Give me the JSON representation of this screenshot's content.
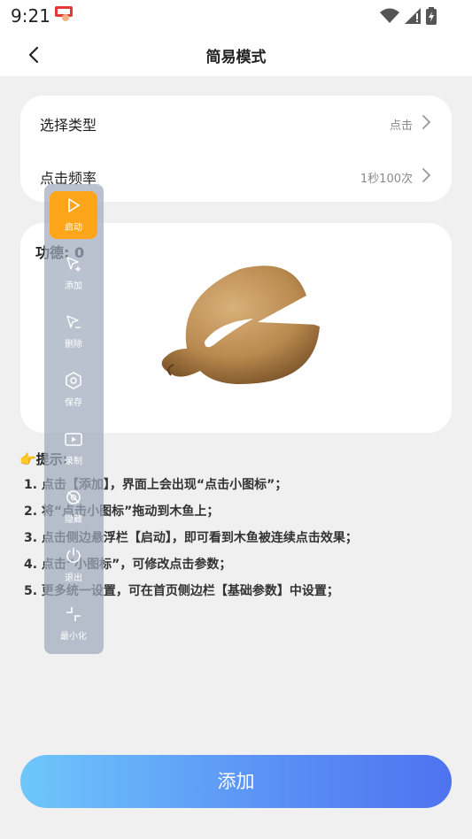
{
  "status": {
    "time": "9:21"
  },
  "header": {
    "title": "简易模式"
  },
  "settings": {
    "type_label": "选择类型",
    "type_value": "点击",
    "freq_label": "点击频率",
    "freq_value": "1秒100次"
  },
  "fish_card": {
    "merit": "功德: 0"
  },
  "tips": {
    "title": "提示:",
    "items": [
      "1. 点击【添加】，界面上会出现“点击小图标”；",
      "2. 将“点击小图标”拖动到木鱼上；",
      "3. 点击侧边悬浮栏【启动】，即可看到木鱼被连续点击效果；",
      "4. 点击“小图标”，可修改点击参数；",
      "5. 更多统一设置，可在首页侧边栏【基础参数】中设置；"
    ]
  },
  "toolbar": {
    "items": [
      {
        "label": "启动",
        "icon": "play-icon"
      },
      {
        "label": "添加",
        "icon": "cursor-plus-icon"
      },
      {
        "label": "删除",
        "icon": "cursor-minus-icon"
      },
      {
        "label": "保存",
        "icon": "hexagon-icon"
      },
      {
        "label": "录制",
        "icon": "record-icon"
      },
      {
        "label": "隐藏",
        "icon": "eye-off-icon"
      },
      {
        "label": "退出",
        "icon": "power-icon"
      },
      {
        "label": "最小化",
        "icon": "minimize-icon"
      }
    ]
  },
  "actions": {
    "add_label": "添加"
  },
  "colors": {
    "active_tool": "#ffa51a",
    "button_gradient_start": "#6ec7fb",
    "button_gradient_end": "#4e73f0"
  }
}
